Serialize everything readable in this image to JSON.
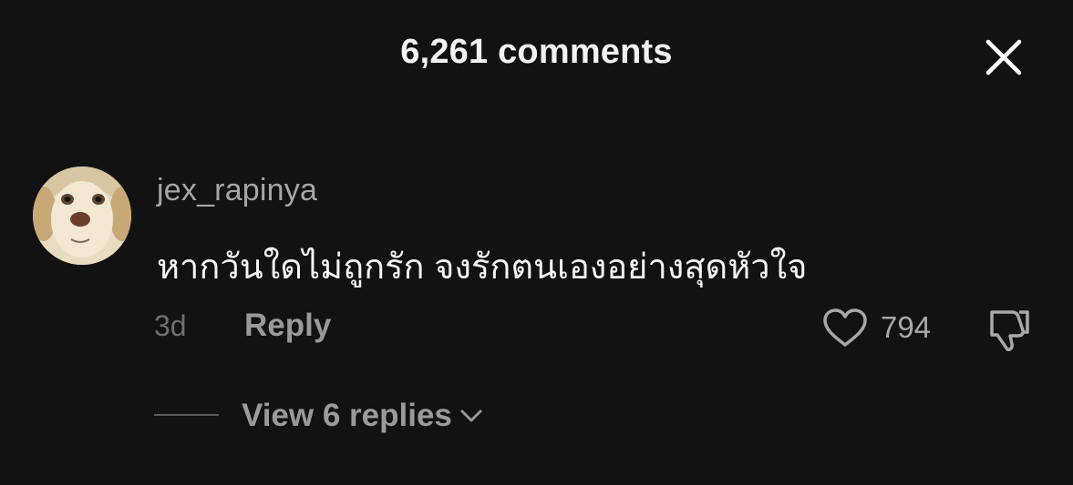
{
  "header": {
    "title": "6,261 comments"
  },
  "comment": {
    "username": "jex_rapinya",
    "text": "หากวันใดไม่ถูกรัก จงรักตนเองอย่างสุดหัวใจ",
    "time": "3d",
    "reply_label": "Reply",
    "like_count": "794",
    "view_replies_label": "View 6 replies"
  },
  "icons": {
    "close": "close-icon",
    "like": "heart-icon",
    "dislike": "thumbs-down-icon",
    "expand": "chevron-down-icon"
  },
  "colors": {
    "background": "#121212",
    "primary_text": "#f4f4f4",
    "secondary_text": "#9a9a9a",
    "muted_text": "#6f6f6f"
  }
}
